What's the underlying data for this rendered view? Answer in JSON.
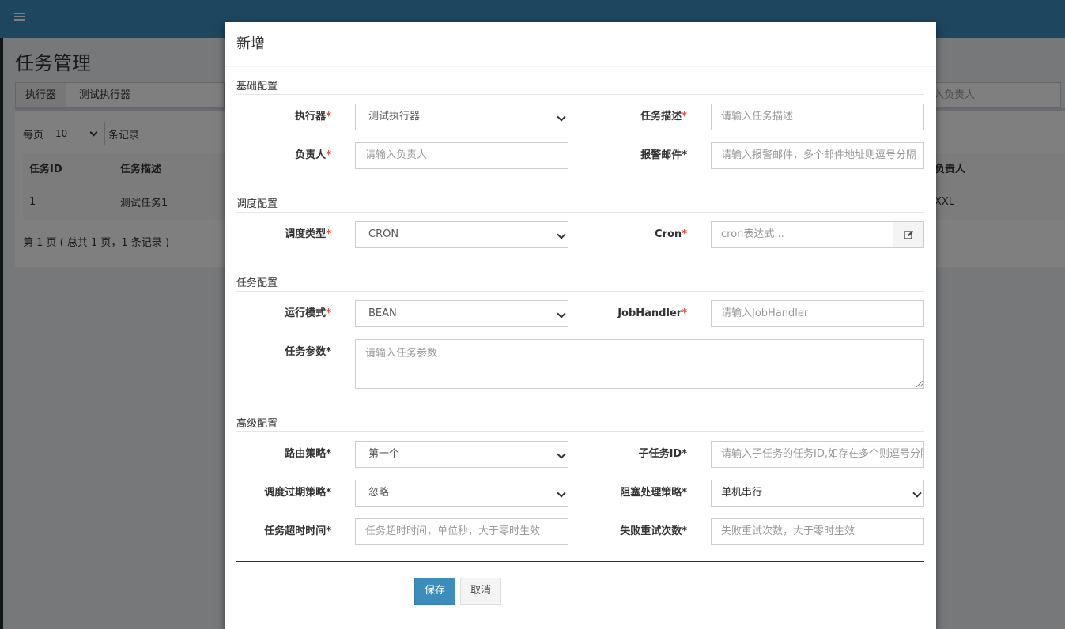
{
  "background": {
    "menu_icon": "hamburger-icon",
    "page_title": "任务管理",
    "filter": {
      "label": "执行器",
      "value": "测试执行器",
      "author_placeholder_fragment": "入负责人"
    },
    "pagination": {
      "per_page_prefix": "每页",
      "per_page_value": "10",
      "per_page_suffix": "条记录",
      "summary": "第 1 页 ( 总共 1 页，1 条记录 )"
    },
    "table": {
      "headers": [
        "任务ID",
        "任务描述",
        "负责人"
      ],
      "rows": [
        {
          "id": "1",
          "desc": "测试任务1",
          "author": "XXL"
        }
      ]
    }
  },
  "modal": {
    "title": "新增",
    "sections": {
      "basic": "基础配置",
      "schedule": "调度配置",
      "job": "任务配置",
      "advanced": "高级配置"
    },
    "fields": {
      "executor": {
        "label": "执行器",
        "required_mark": "*",
        "value": "测试执行器"
      },
      "job_desc": {
        "label": "任务描述",
        "required_mark": "*",
        "placeholder": "请输入任务描述"
      },
      "author": {
        "label": "负责人",
        "required_mark": "*",
        "placeholder": "请输入负责人"
      },
      "alarm_email": {
        "label": "报警邮件*",
        "placeholder": "请输入报警邮件，多个邮件地址则逗号分隔"
      },
      "schedule_type": {
        "label": "调度类型",
        "required_mark": "*",
        "value": "CRON"
      },
      "cron": {
        "label": "Cron",
        "required_mark": "*",
        "placeholder": "cron表达式...",
        "addon_icon": "edit-icon"
      },
      "glue_type": {
        "label": "运行模式",
        "required_mark": "*",
        "value": "BEAN"
      },
      "job_handler": {
        "label": "JobHandler",
        "required_mark": "*",
        "placeholder": "请输入JobHandler"
      },
      "job_param": {
        "label": "任务参数*",
        "placeholder": "请输入任务参数"
      },
      "route_strategy": {
        "label": "路由策略*",
        "value": "第一个"
      },
      "child_job_id": {
        "label": "子任务ID*",
        "placeholder": "请输入子任务的任务ID,如存在多个则逗号分隔"
      },
      "misfire_strategy": {
        "label": "调度过期策略*",
        "value": "忽略"
      },
      "block_strategy": {
        "label": "阻塞处理策略*",
        "value": "单机串行"
      },
      "timeout": {
        "label": "任务超时时间*",
        "placeholder": "任务超时时间，单位秒，大于零时生效"
      },
      "fail_retry": {
        "label": "失败重试次数*",
        "placeholder": "失败重试次数，大于零时生效"
      }
    },
    "buttons": {
      "save": "保存",
      "cancel": "取消"
    }
  }
}
